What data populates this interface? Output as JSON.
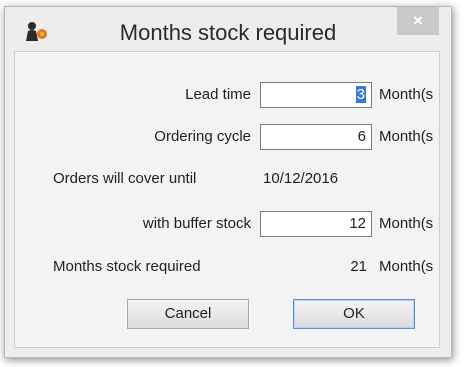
{
  "dialog": {
    "title": "Months stock required",
    "close_label": "×"
  },
  "form": {
    "lead_time": {
      "label": "Lead time",
      "value": "3",
      "unit": "Month(s"
    },
    "ordering_cycle": {
      "label": "Ordering cycle",
      "value": "6",
      "unit": "Month(s"
    },
    "orders_cover": {
      "label": "Orders will cover until",
      "value": "10/12/2016"
    },
    "buffer_stock": {
      "label": "with buffer stock",
      "value": "12",
      "unit": "Month(s"
    },
    "months_required": {
      "label": "Months stock required",
      "value": "21",
      "unit": "Month(s"
    }
  },
  "buttons": {
    "cancel": "Cancel",
    "ok": "OK"
  }
}
